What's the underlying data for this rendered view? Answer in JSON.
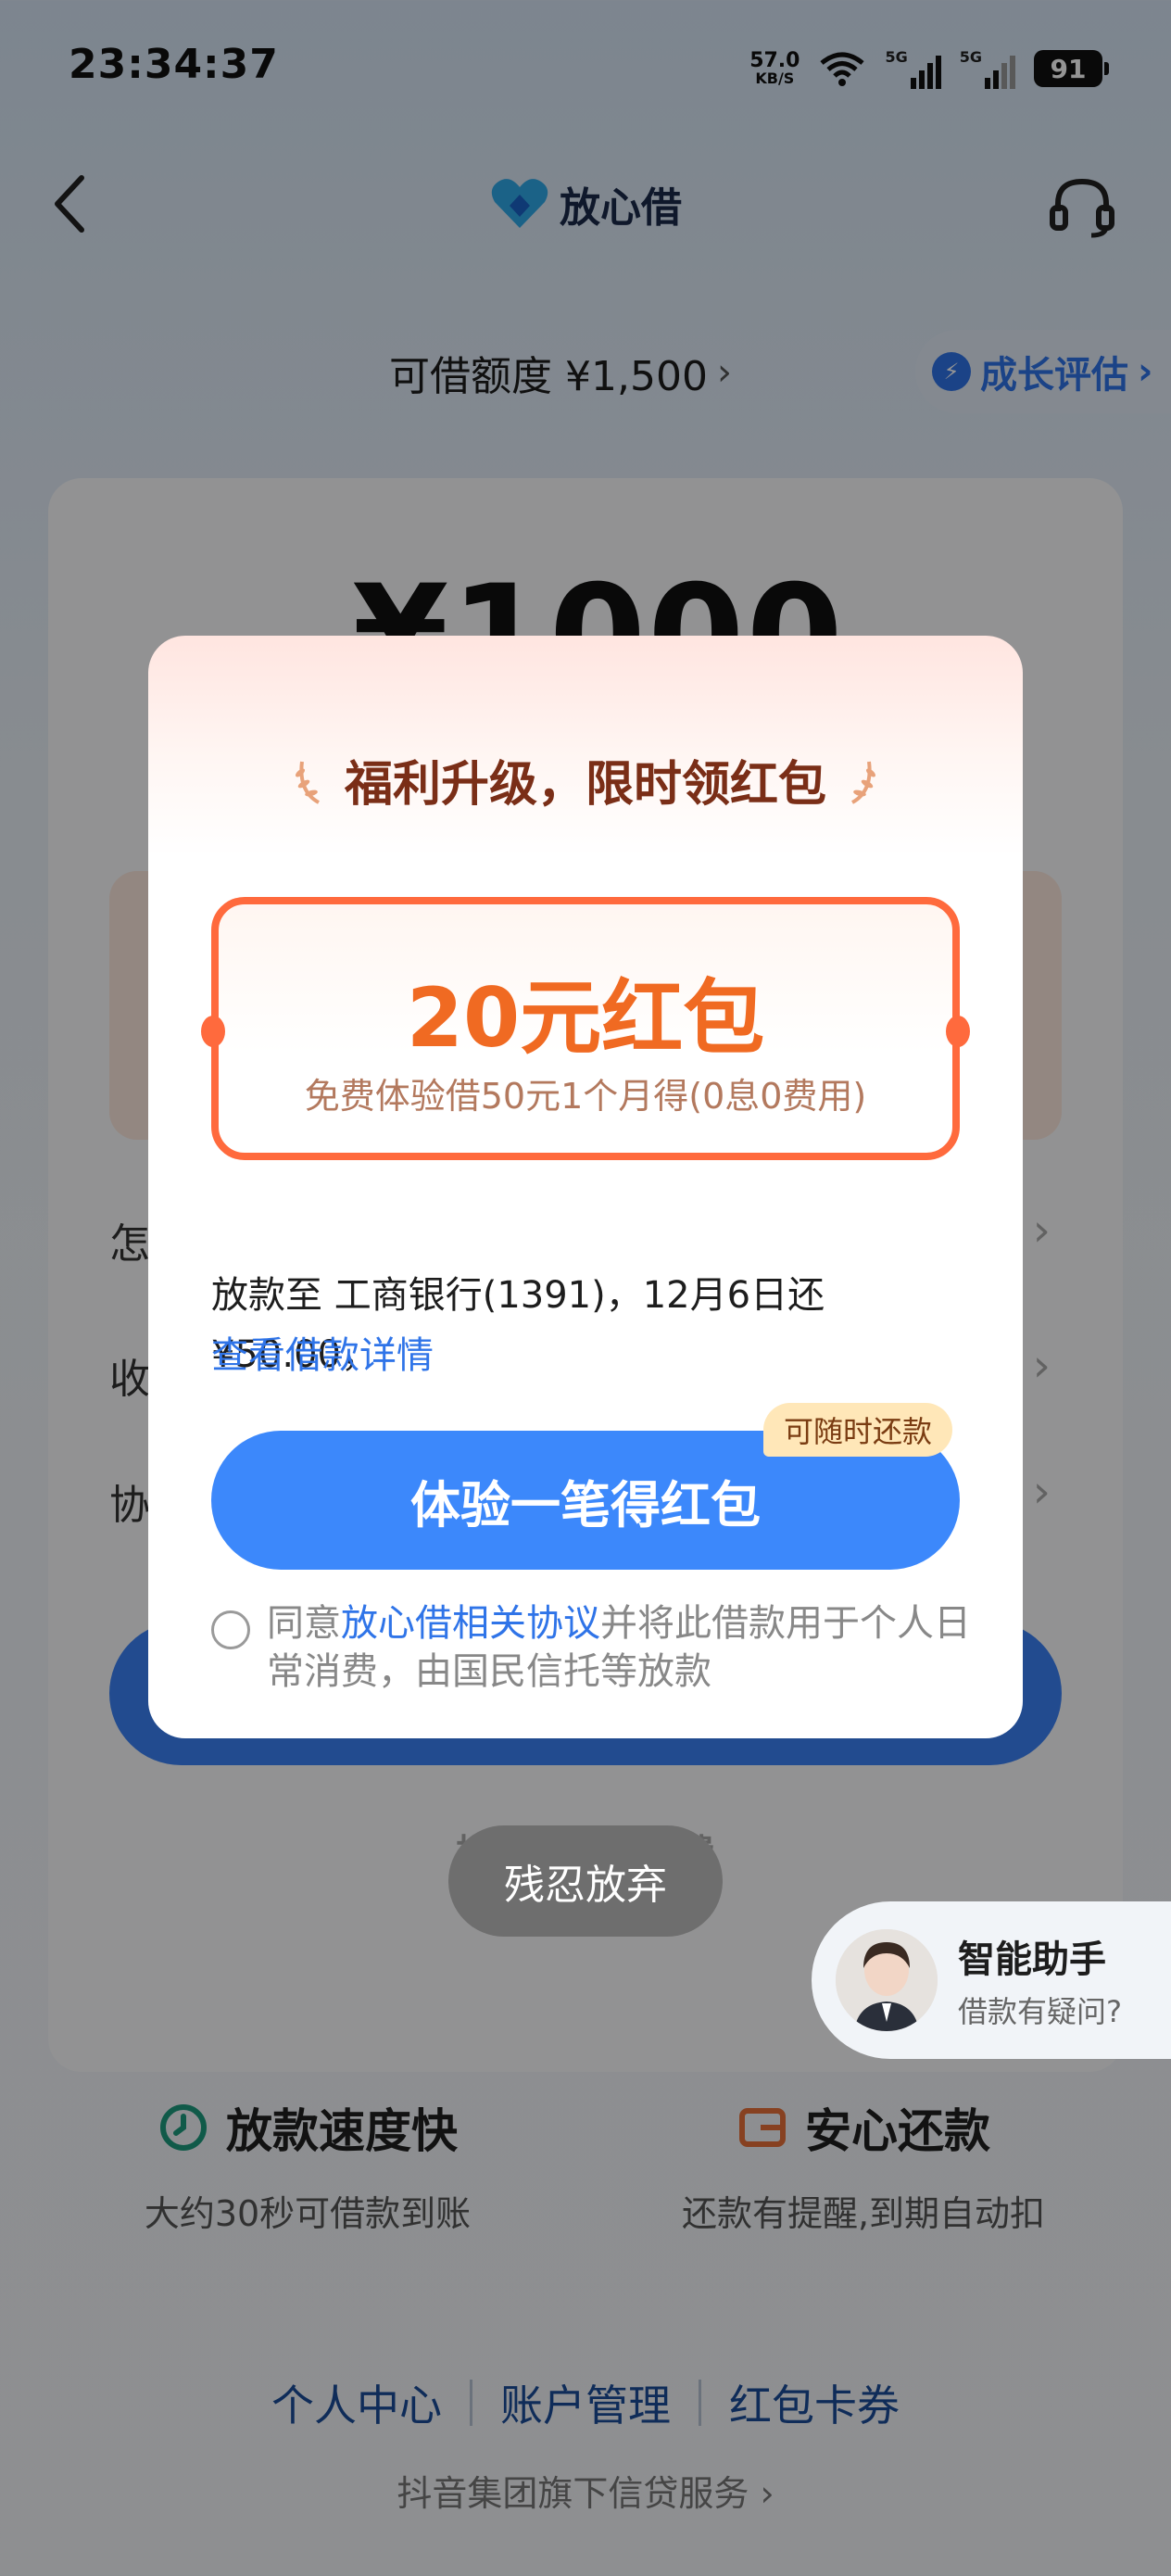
{
  "status_bar": {
    "time": "23:34:37",
    "net_speed": "57.0",
    "net_unit": "KB/S",
    "signal1": "5G",
    "signal2": "5G",
    "battery": "91"
  },
  "nav": {
    "brand": "放心借"
  },
  "credit": {
    "label": "可借额度 ¥1,500",
    "growth": "成长评估"
  },
  "main": {
    "amount": "¥1000",
    "row1": "怎",
    "row2": "收",
    "row3": "协",
    "daily_note": "按天计息                手续费"
  },
  "dialog": {
    "title": "福利升级，限时领红包",
    "ticket_amount": "20元红包",
    "ticket_desc": "免费体验借50元1个月得(0息0费用)",
    "loan_info": "放款至 工商银行(1391)，12月6日还¥50.00，",
    "loan_detail_link": "查看借款详情",
    "cta": "体验一笔得红包",
    "cta_badge": "可随时还款",
    "agree_prefix": "同意",
    "agree_link": "放心借相关协议",
    "agree_suffix": "并将此借款用于个人日常消费，由国民信托等放款"
  },
  "giveup": "残忍放弃",
  "assistant": {
    "name": "智能助手",
    "sub": "借款有疑问?"
  },
  "features": [
    {
      "title": "放款速度快",
      "sub": "大约30秒可借款到账"
    },
    {
      "title": "安心还款",
      "sub": "还款有提醒,到期自动扣"
    }
  ],
  "footer": {
    "links": [
      "个人中心",
      "账户管理",
      "红包卡券"
    ],
    "note": "抖音集团旗下信贷服务"
  }
}
